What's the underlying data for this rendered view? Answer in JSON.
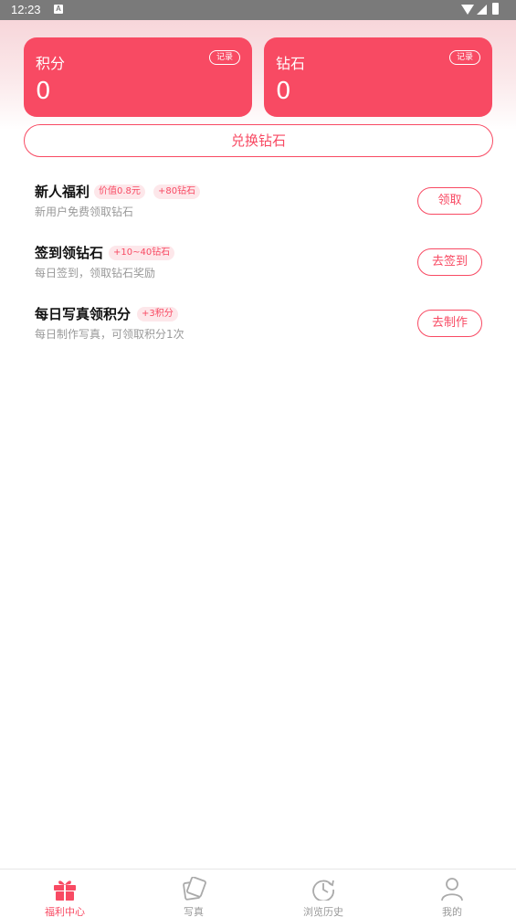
{
  "status_bar": {
    "time": "12:23",
    "notif_letter": "A"
  },
  "cards": {
    "points": {
      "title": "积分",
      "value": "0",
      "record_label": "记录"
    },
    "diamonds": {
      "title": "钻石",
      "value": "0",
      "record_label": "记录"
    }
  },
  "exchange_button": "兑换钻石",
  "tasks": [
    {
      "title": "新人福利",
      "tags": [
        "价值0.8元",
        "+80钻石"
      ],
      "desc": "新用户免费领取钻石",
      "button": "领取"
    },
    {
      "title": "签到领钻石",
      "tags": [
        "+10~40钻石"
      ],
      "desc": "每日签到，领取钻石奖励",
      "button": "去签到"
    },
    {
      "title": "每日写真领积分",
      "tags": [
        "+3积分"
      ],
      "desc": "每日制作写真，可领取积分1次",
      "button": "去制作"
    }
  ],
  "tabbar": [
    {
      "label": "福利中心",
      "icon": "gift-icon",
      "active": true
    },
    {
      "label": "写真",
      "icon": "photo-cards-icon",
      "active": false
    },
    {
      "label": "浏览历史",
      "icon": "history-clock-icon",
      "active": false
    },
    {
      "label": "我的",
      "icon": "person-icon",
      "active": false
    }
  ],
  "colors": {
    "accent": "#f84a63",
    "tag_bg": "#fde7ea",
    "muted_text": "#999999"
  }
}
